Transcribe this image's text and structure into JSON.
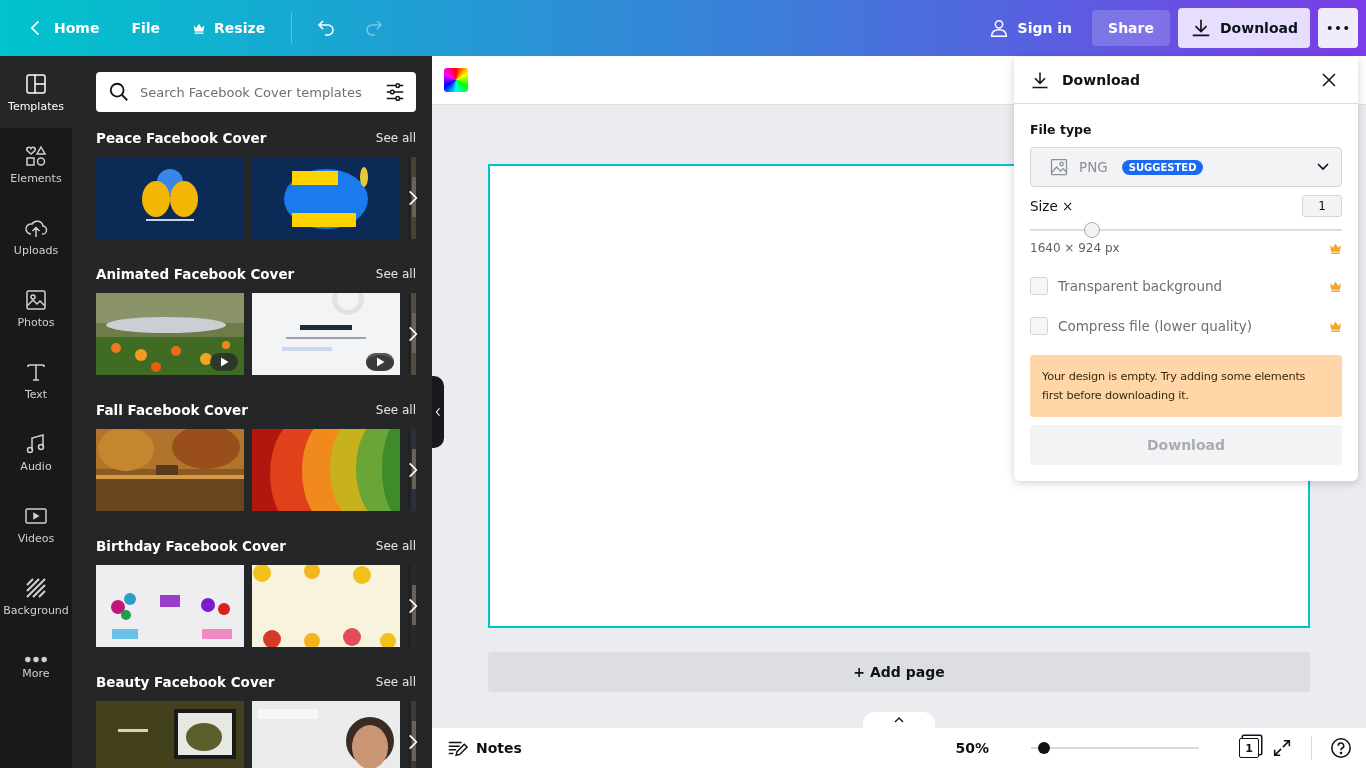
{
  "top_bar": {
    "home": "Home",
    "menu": [
      "File",
      "Resize"
    ],
    "sign_in": "Sign in",
    "share": "Share",
    "download": {
      "label": "Download",
      "selected": true
    },
    "undo_disabled": false,
    "redo_disabled": true
  },
  "rail": [
    {
      "label": "Templates",
      "selected": true,
      "kind": "templates"
    },
    {
      "label": "Elements",
      "selected": false,
      "kind": "elements"
    },
    {
      "label": "Uploads",
      "selected": false,
      "kind": "uploads"
    },
    {
      "label": "Photos",
      "selected": false,
      "kind": "photos"
    },
    {
      "label": "Text",
      "selected": false,
      "kind": "text"
    },
    {
      "label": "Audio",
      "selected": false,
      "kind": "audio"
    },
    {
      "label": "Videos",
      "selected": false,
      "kind": "videos"
    },
    {
      "label": "Background",
      "selected": false,
      "kind": "background"
    },
    {
      "label": "More",
      "selected": false,
      "kind": "more"
    }
  ],
  "search": {
    "placeholder": "Search Facebook Cover templates"
  },
  "sections": [
    {
      "title": "Peace Facebook Cover",
      "see_all": "See all",
      "thumbnails": [
        {
          "kind": "picture",
          "video": false
        },
        {
          "kind": "picture",
          "video": false
        }
      ]
    },
    {
      "title": "Animated Facebook Cover",
      "see_all": "See all",
      "thumbnails": [
        {
          "kind": "picture",
          "video": true
        },
        {
          "kind": "picture",
          "video": true
        }
      ]
    },
    {
      "title": "Fall Facebook Cover",
      "see_all": "See all",
      "thumbnails": [
        {
          "kind": "picture",
          "video": false
        },
        {
          "kind": "picture",
          "video": false
        }
      ]
    },
    {
      "title": "Birthday Facebook Cover",
      "see_all": "See all",
      "thumbnails": [
        {
          "kind": "picture",
          "video": false
        },
        {
          "kind": "picture",
          "video": false
        }
      ]
    },
    {
      "title": "Beauty Facebook Cover",
      "see_all": "See all",
      "thumbnails": [
        {
          "kind": "picture",
          "video": false
        },
        {
          "kind": "picture",
          "video": false
        }
      ]
    }
  ],
  "canvas": {
    "add_page": "+ Add page"
  },
  "download_panel": {
    "title": "Download",
    "file_type_label": "File type",
    "file_type": "PNG",
    "badge": "SUGGESTED",
    "size_label": "Size ×",
    "size_value": "1",
    "size_slider": {
      "level": 0.2
    },
    "dimensions": "1640 × 924 px",
    "dimensions_premium": true,
    "options": [
      {
        "label": "Transparent background",
        "checked": false,
        "premium": true
      },
      {
        "label": "Compress file (lower quality)",
        "checked": false,
        "premium": true
      }
    ],
    "warning": "Your design is empty. Try adding some elements first before downloading it.",
    "button": {
      "label": "Download",
      "disabled": true
    }
  },
  "bottom_bar": {
    "notes": "Notes",
    "zoom": "50%",
    "zoom_slider": {
      "level": 0.08
    },
    "page_count": "1"
  }
}
